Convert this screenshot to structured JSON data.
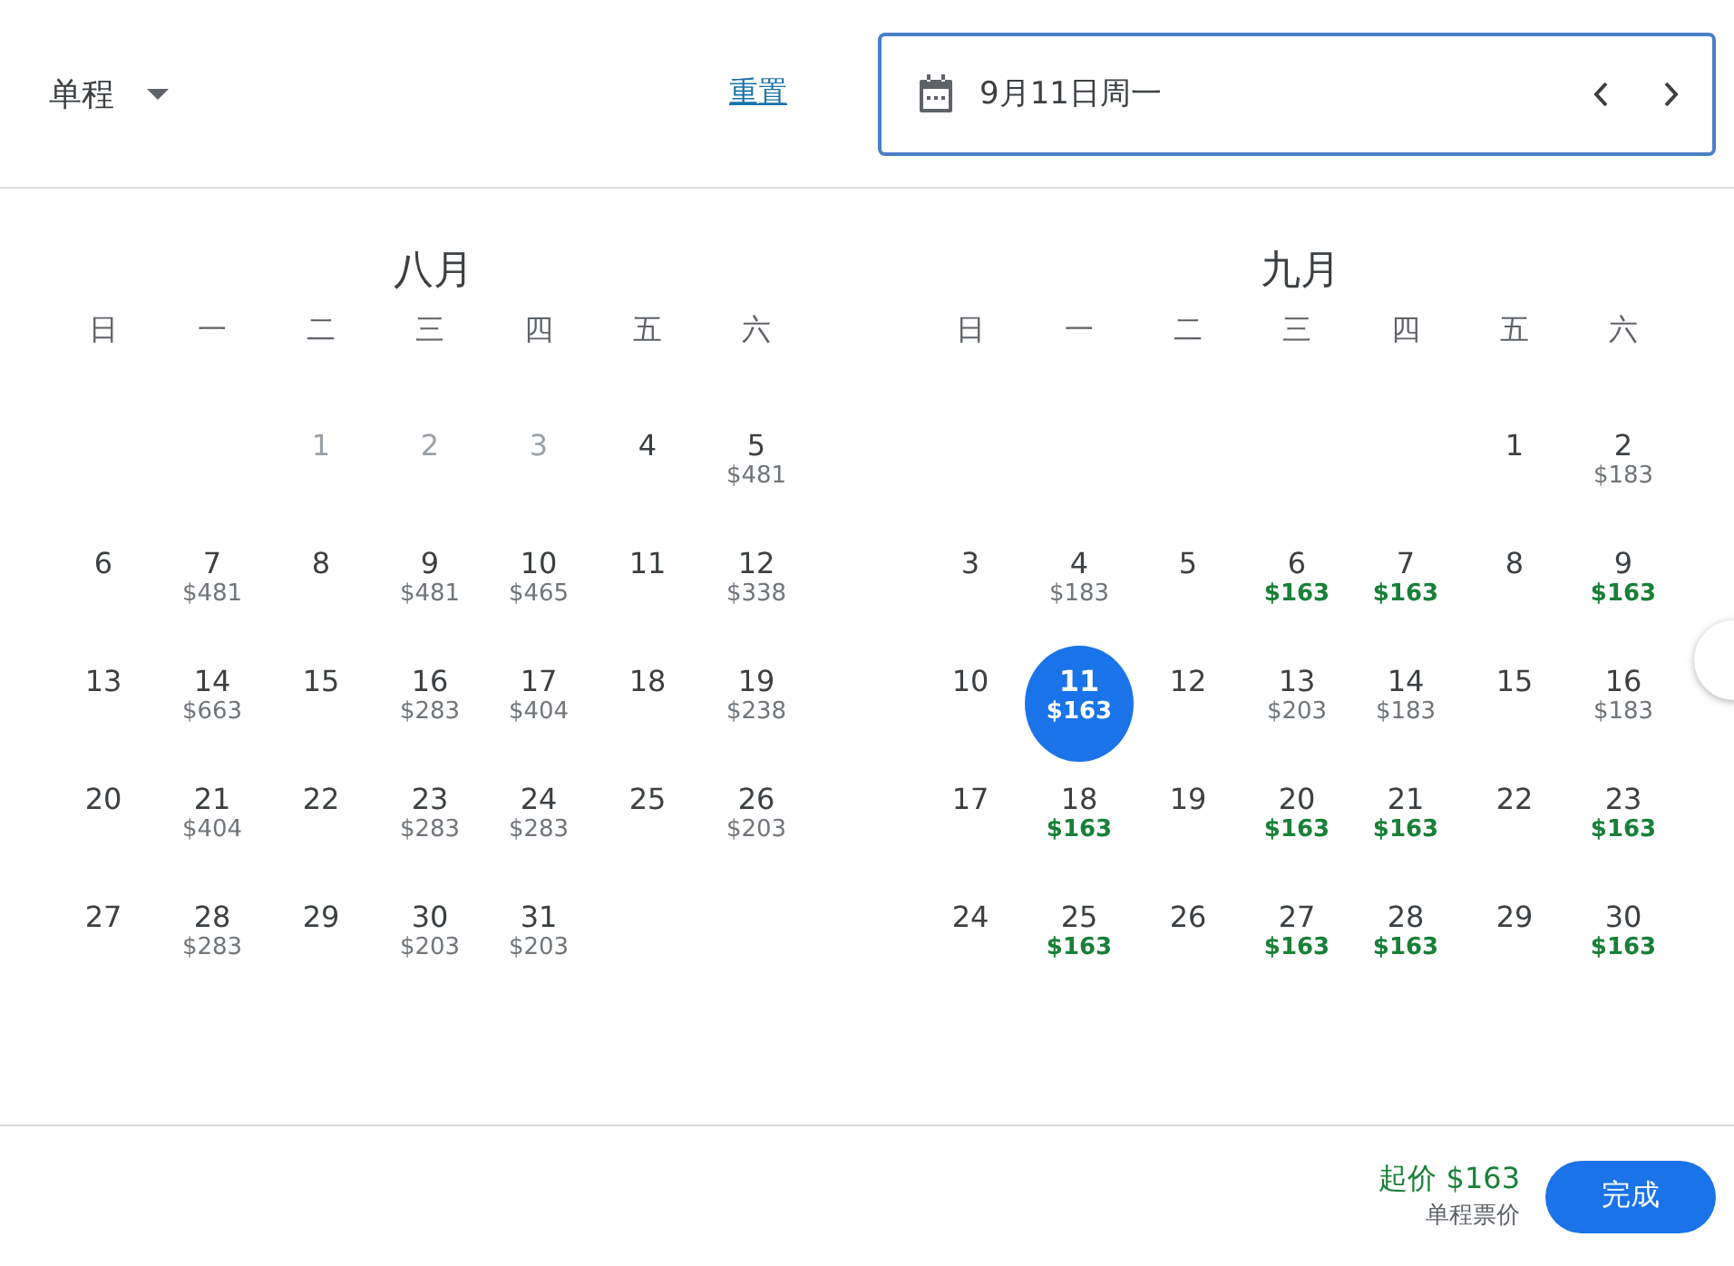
{
  "trip_type": {
    "label": "单程"
  },
  "reset_link": "重置",
  "date_field": {
    "value": "9月11日周一"
  },
  "months": [
    {
      "title": "八月",
      "weekdays": [
        "日",
        "一",
        "二",
        "三",
        "四",
        "五",
        "六"
      ],
      "weeks": [
        [
          {
            "kind": "blank"
          },
          {
            "kind": "blank"
          },
          {
            "kind": "day",
            "day": "1",
            "disabled": true,
            "selected": false
          },
          {
            "kind": "day",
            "day": "2",
            "disabled": true,
            "selected": false
          },
          {
            "kind": "day",
            "day": "3",
            "disabled": true,
            "selected": false
          },
          {
            "kind": "day",
            "day": "4",
            "disabled": false,
            "selected": false
          },
          {
            "kind": "day",
            "day": "5",
            "price": "$481",
            "cheap": false,
            "disabled": false,
            "selected": false
          }
        ],
        [
          {
            "kind": "day",
            "day": "6",
            "disabled": false,
            "selected": false
          },
          {
            "kind": "day",
            "day": "7",
            "price": "$481",
            "cheap": false,
            "disabled": false,
            "selected": false
          },
          {
            "kind": "day",
            "day": "8",
            "disabled": false,
            "selected": false
          },
          {
            "kind": "day",
            "day": "9",
            "price": "$481",
            "cheap": false,
            "disabled": false,
            "selected": false
          },
          {
            "kind": "day",
            "day": "10",
            "price": "$465",
            "cheap": false,
            "disabled": false,
            "selected": false
          },
          {
            "kind": "day",
            "day": "11",
            "disabled": false,
            "selected": false
          },
          {
            "kind": "day",
            "day": "12",
            "price": "$338",
            "cheap": false,
            "disabled": false,
            "selected": false
          }
        ],
        [
          {
            "kind": "day",
            "day": "13",
            "disabled": false,
            "selected": false
          },
          {
            "kind": "day",
            "day": "14",
            "price": "$663",
            "cheap": false,
            "disabled": false,
            "selected": false
          },
          {
            "kind": "day",
            "day": "15",
            "disabled": false,
            "selected": false
          },
          {
            "kind": "day",
            "day": "16",
            "price": "$283",
            "cheap": false,
            "disabled": false,
            "selected": false
          },
          {
            "kind": "day",
            "day": "17",
            "price": "$404",
            "cheap": false,
            "disabled": false,
            "selected": false
          },
          {
            "kind": "day",
            "day": "18",
            "disabled": false,
            "selected": false
          },
          {
            "kind": "day",
            "day": "19",
            "price": "$238",
            "cheap": false,
            "disabled": false,
            "selected": false
          }
        ],
        [
          {
            "kind": "day",
            "day": "20",
            "disabled": false,
            "selected": false
          },
          {
            "kind": "day",
            "day": "21",
            "price": "$404",
            "cheap": false,
            "disabled": false,
            "selected": false
          },
          {
            "kind": "day",
            "day": "22",
            "disabled": false,
            "selected": false
          },
          {
            "kind": "day",
            "day": "23",
            "price": "$283",
            "cheap": false,
            "disabled": false,
            "selected": false
          },
          {
            "kind": "day",
            "day": "24",
            "price": "$283",
            "cheap": false,
            "disabled": false,
            "selected": false
          },
          {
            "kind": "day",
            "day": "25",
            "disabled": false,
            "selected": false
          },
          {
            "kind": "day",
            "day": "26",
            "price": "$203",
            "cheap": false,
            "disabled": false,
            "selected": false
          }
        ],
        [
          {
            "kind": "day",
            "day": "27",
            "disabled": false,
            "selected": false
          },
          {
            "kind": "day",
            "day": "28",
            "price": "$283",
            "cheap": false,
            "disabled": false,
            "selected": false
          },
          {
            "kind": "day",
            "day": "29",
            "disabled": false,
            "selected": false
          },
          {
            "kind": "day",
            "day": "30",
            "price": "$203",
            "cheap": false,
            "disabled": false,
            "selected": false
          },
          {
            "kind": "day",
            "day": "31",
            "price": "$203",
            "cheap": false,
            "disabled": false,
            "selected": false
          }
        ]
      ]
    },
    {
      "title": "九月",
      "weekdays": [
        "日",
        "一",
        "二",
        "三",
        "四",
        "五",
        "六"
      ],
      "weeks": [
        [
          {
            "kind": "blank"
          },
          {
            "kind": "blank"
          },
          {
            "kind": "blank"
          },
          {
            "kind": "blank"
          },
          {
            "kind": "blank"
          },
          {
            "kind": "day",
            "day": "1",
            "disabled": false,
            "selected": false
          },
          {
            "kind": "day",
            "day": "2",
            "price": "$183",
            "cheap": false,
            "disabled": false,
            "selected": false
          }
        ],
        [
          {
            "kind": "day",
            "day": "3",
            "disabled": false,
            "selected": false
          },
          {
            "kind": "day",
            "day": "4",
            "price": "$183",
            "cheap": false,
            "disabled": false,
            "selected": false
          },
          {
            "kind": "day",
            "day": "5",
            "disabled": false,
            "selected": false
          },
          {
            "kind": "day",
            "day": "6",
            "price": "$163",
            "cheap": true,
            "disabled": false,
            "selected": false
          },
          {
            "kind": "day",
            "day": "7",
            "price": "$163",
            "cheap": true,
            "disabled": false,
            "selected": false
          },
          {
            "kind": "day",
            "day": "8",
            "disabled": false,
            "selected": false
          },
          {
            "kind": "day",
            "day": "9",
            "price": "$163",
            "cheap": true,
            "disabled": false,
            "selected": false
          }
        ],
        [
          {
            "kind": "day",
            "day": "10",
            "disabled": false,
            "selected": false
          },
          {
            "kind": "day",
            "day": "11",
            "price": "$163",
            "cheap": true,
            "disabled": false,
            "selected": true
          },
          {
            "kind": "day",
            "day": "12",
            "disabled": false,
            "selected": false
          },
          {
            "kind": "day",
            "day": "13",
            "price": "$203",
            "cheap": false,
            "disabled": false,
            "selected": false
          },
          {
            "kind": "day",
            "day": "14",
            "price": "$183",
            "cheap": false,
            "disabled": false,
            "selected": false
          },
          {
            "kind": "day",
            "day": "15",
            "disabled": false,
            "selected": false
          },
          {
            "kind": "day",
            "day": "16",
            "price": "$183",
            "cheap": false,
            "disabled": false,
            "selected": false
          }
        ],
        [
          {
            "kind": "day",
            "day": "17",
            "disabled": false,
            "selected": false
          },
          {
            "kind": "day",
            "day": "18",
            "price": "$163",
            "cheap": true,
            "disabled": false,
            "selected": false
          },
          {
            "kind": "day",
            "day": "19",
            "disabled": false,
            "selected": false
          },
          {
            "kind": "day",
            "day": "20",
            "price": "$163",
            "cheap": true,
            "disabled": false,
            "selected": false
          },
          {
            "kind": "day",
            "day": "21",
            "price": "$163",
            "cheap": true,
            "disabled": false,
            "selected": false
          },
          {
            "kind": "day",
            "day": "22",
            "disabled": false,
            "selected": false
          },
          {
            "kind": "day",
            "day": "23",
            "price": "$163",
            "cheap": true,
            "disabled": false,
            "selected": false
          }
        ],
        [
          {
            "kind": "day",
            "day": "24",
            "disabled": false,
            "selected": false
          },
          {
            "kind": "day",
            "day": "25",
            "price": "$163",
            "cheap": true,
            "disabled": false,
            "selected": false
          },
          {
            "kind": "day",
            "day": "26",
            "disabled": false,
            "selected": false
          },
          {
            "kind": "day",
            "day": "27",
            "price": "$163",
            "cheap": true,
            "disabled": false,
            "selected": false
          },
          {
            "kind": "day",
            "day": "28",
            "price": "$163",
            "cheap": true,
            "disabled": false,
            "selected": false
          },
          {
            "kind": "day",
            "day": "29",
            "disabled": false,
            "selected": false
          },
          {
            "kind": "day",
            "day": "30",
            "price": "$163",
            "cheap": true,
            "disabled": false,
            "selected": false
          }
        ]
      ]
    }
  ],
  "footer": {
    "price": "起价 $163",
    "price_note": "单程票价",
    "done_button": "完成"
  }
}
